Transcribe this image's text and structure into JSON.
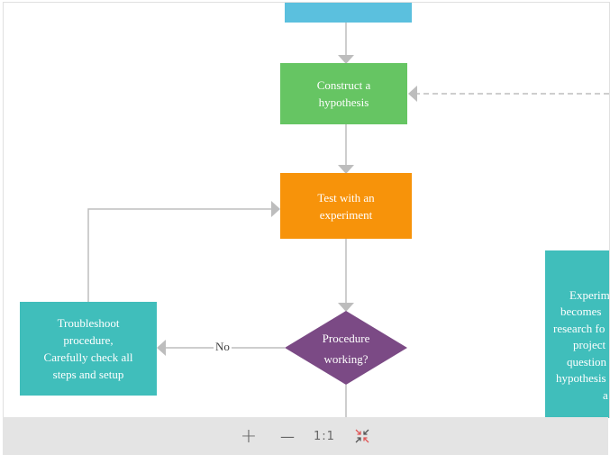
{
  "nodes": {
    "top": {
      "label": "",
      "color": "#5bc0de"
    },
    "hypothesis": {
      "label_lines": [
        "Construct a",
        "hypothesis"
      ],
      "color": "#66c563"
    },
    "experiment": {
      "label_lines": [
        "Test with an",
        "experiment"
      ],
      "color": "#f7930a"
    },
    "decision": {
      "label_lines": [
        "Procedure",
        "working?"
      ],
      "color": "#7b4a85"
    },
    "troubleshoot": {
      "label_lines": [
        "Troubleshoot",
        "procedure,",
        "Carefully check all",
        "steps and setup"
      ],
      "color": "#40bebb"
    },
    "right_box": {
      "visible_lines": [
        "Experim",
        "becomes",
        "research fo",
        "project",
        "question",
        "hypothesis",
        "a"
      ],
      "color": "#40bebb"
    }
  },
  "edges": {
    "no_label": "No",
    "line_color": "#bdbdbd"
  },
  "toolbar": {
    "zoom_in_icon": "+",
    "zoom_out_icon": "—",
    "actual_size_label": "1:1",
    "fit_icon": "collapse-arrows"
  }
}
